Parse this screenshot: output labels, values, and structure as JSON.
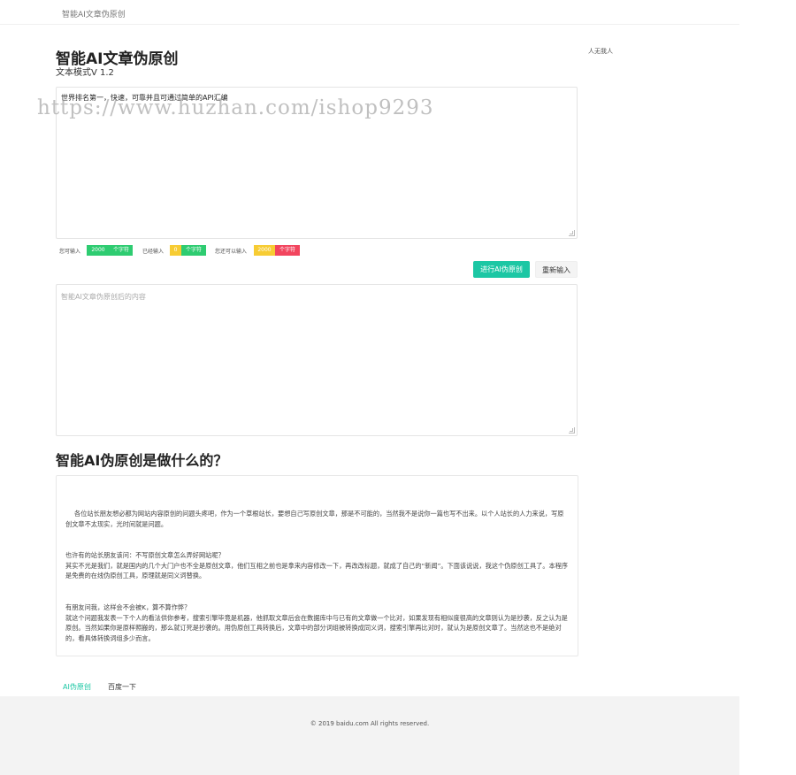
{
  "header": {
    "brand": "智能AI文章伪原创"
  },
  "page": {
    "title": "智能AI文章伪原创",
    "subtitle": "文本模式V 1.2",
    "side_text": "人无我人"
  },
  "input": {
    "value": "世界排名第一，快速，可靠并且可通过简单的API汇编"
  },
  "watermark": "https://www.huzhan.com/ishop9293",
  "counters": {
    "allowed": {
      "label": "您可输入",
      "value": "2000",
      "unit": "个字符"
    },
    "entered": {
      "label": "已经输入",
      "value": "0",
      "unit": "个字符"
    },
    "max": {
      "label": "您还可以输入",
      "value": "2000",
      "unit": "个字符"
    }
  },
  "buttons": {
    "rewrite": "进行AI伪原创",
    "reset": "重新输入"
  },
  "output": {
    "placeholder": "智能AI文章伪原创后的内容"
  },
  "info": {
    "title": "智能AI伪原创是做什么的？",
    "p1": "各位站长朋友想必都为网站内容原创的问题头疼吧，作为一个草根站长，要想自己写原创文章，那是不可能的，当然我不是说你一篇也写不出来。以个人站长的人力来说，写原创文章不太现实，光时间就是问题。",
    "p2_q": "也许有的站长朋友该问：不写原创文章怎么弄好网站呢？",
    "p2": "其实不光是我们，就是国内的几个大门户也不全是原创文章，他们互相之前也是拿来内容修改一下，再改改标题，就成了自己的“新闻”。下面该说说，我这个伪原创工具了。本程序是免费的在线伪原创工具，原理就是同义词替换。",
    "p3_q": "有朋友问我，这样会不会被K，算不算作弊？",
    "p3": "就这个问题我发表一下个人的看法供你参考，搜索引擎毕竟是机器，他抓取文章后会在数据库中与已有的文章做一个比对，如果发现有相似度很高的文章则认为是抄袭，反之认为是原创。当然如果你是原样照搬的，那么就订死是抄袭的。用伪原创工具转换后，文章中的部分词组被转换成同义词，搜索引擎再比对时，就认为是原创文章了。当然这也不是绝对的，看具体转换词组多少而言。"
  },
  "footer_links": {
    "ai": "AI伪原创",
    "baidu": "百度一下"
  },
  "footer": {
    "copyright": "© 2019 baidu.com All rights reserved."
  }
}
